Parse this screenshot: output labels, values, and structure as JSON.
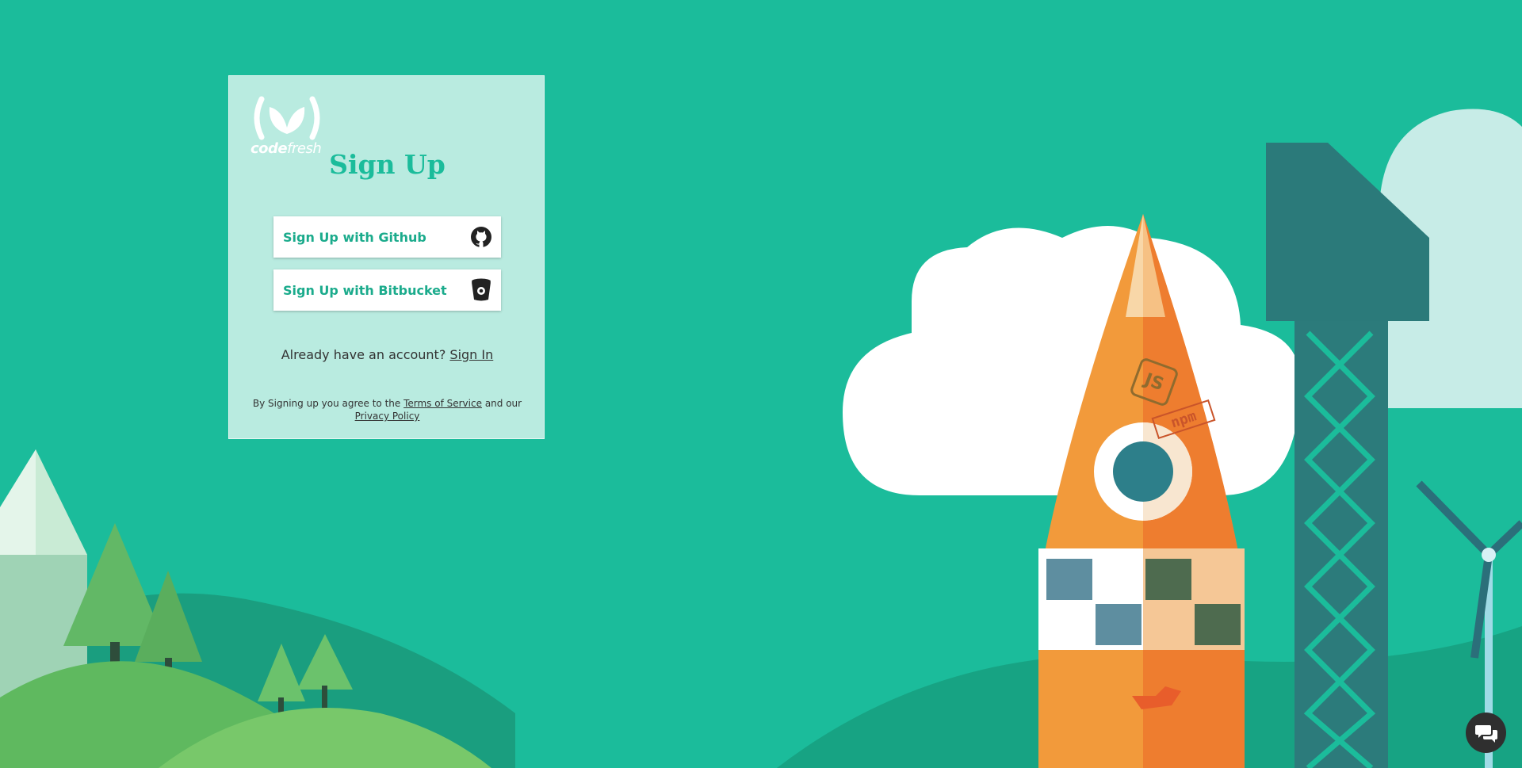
{
  "brand": {
    "logo_text_bold": "code",
    "logo_text_light": "fresh",
    "accent_color": "#1bbc9b"
  },
  "signup": {
    "title": "Sign Up",
    "github_label": "Sign Up with Github",
    "github_icon": "github-icon",
    "bitbucket_label": "Sign Up with Bitbucket",
    "bitbucket_icon": "bitbucket-icon",
    "account_prompt": "Already have an account?",
    "signin_link": "Sign In",
    "terms_prefix": "By Signing up you agree to the",
    "terms_link": "Terms of Service",
    "terms_middle": "and our",
    "privacy_link": "Privacy Policy"
  },
  "illustration": {
    "rocket_badges": [
      "JS",
      "npm"
    ]
  },
  "chat": {
    "icon": "chat-bubbles-icon"
  }
}
